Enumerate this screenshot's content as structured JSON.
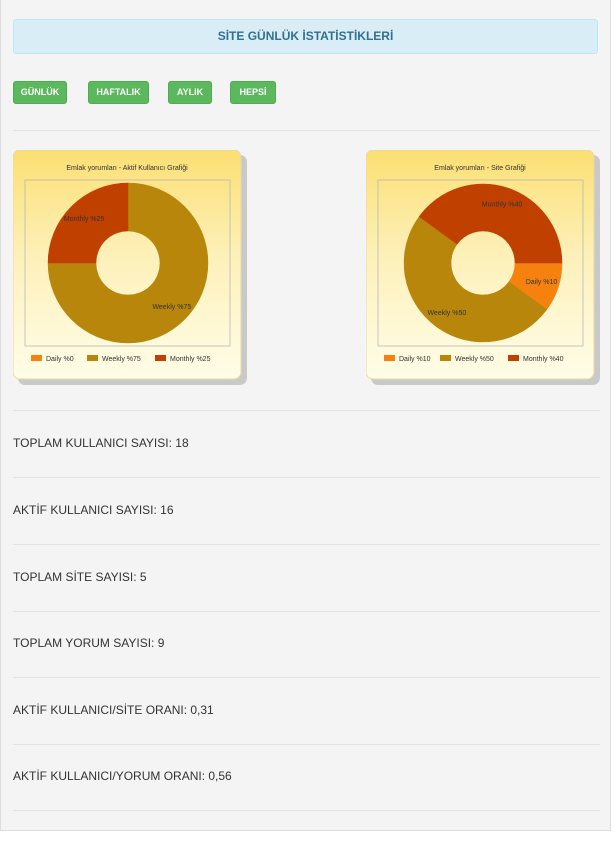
{
  "header": {
    "title": "SİTE GÜNLÜK İSTATİSTİKLERİ"
  },
  "period_buttons": {
    "daily": "GÜNLÜK",
    "weekly": "HAFTALIK",
    "monthly": "AYLIK",
    "all": "HEPSİ"
  },
  "colors": {
    "daily": "#f7810f",
    "weekly": "#b8860b",
    "monthly": "#c04000"
  },
  "chart_data": [
    {
      "type": "pie",
      "title": "Emlak yorumları - Aktif Kullanıcı Grafiği",
      "categories": [
        "Daily",
        "Weekly",
        "Monthly"
      ],
      "values": [
        0,
        75,
        25
      ],
      "slice_labels": [
        "Daily %0",
        "Weekly %75",
        "Monthly %25"
      ],
      "legend": [
        "Daily %0",
        "Weekly %75",
        "Monthly %25"
      ],
      "legend_position": "bottom"
    },
    {
      "type": "pie",
      "title": "Emlak yorumları - Site Grafiği",
      "categories": [
        "Daily",
        "Weekly",
        "Monthly"
      ],
      "values": [
        10,
        50,
        40
      ],
      "slice_labels": [
        "Daily %10",
        "Weekly %50",
        "Monthly %40"
      ],
      "legend": [
        "Daily %10",
        "Weekly %50",
        "Monthly %40"
      ],
      "legend_position": "bottom"
    }
  ],
  "stats": [
    {
      "text": "TOPLAM KULLANICI SAYISI: 18"
    },
    {
      "text": "AKTİF KULLANICI SAYISI: 16"
    },
    {
      "text": "TOPLAM SİTE SAYISI: 5"
    },
    {
      "text": "TOPLAM YORUM SAYISI: 9"
    },
    {
      "text": "AKTİF KULLANICI/SİTE ORANI: 0,31"
    },
    {
      "text": "AKTİF KULLANICI/YORUM ORANI: 0,56"
    }
  ]
}
